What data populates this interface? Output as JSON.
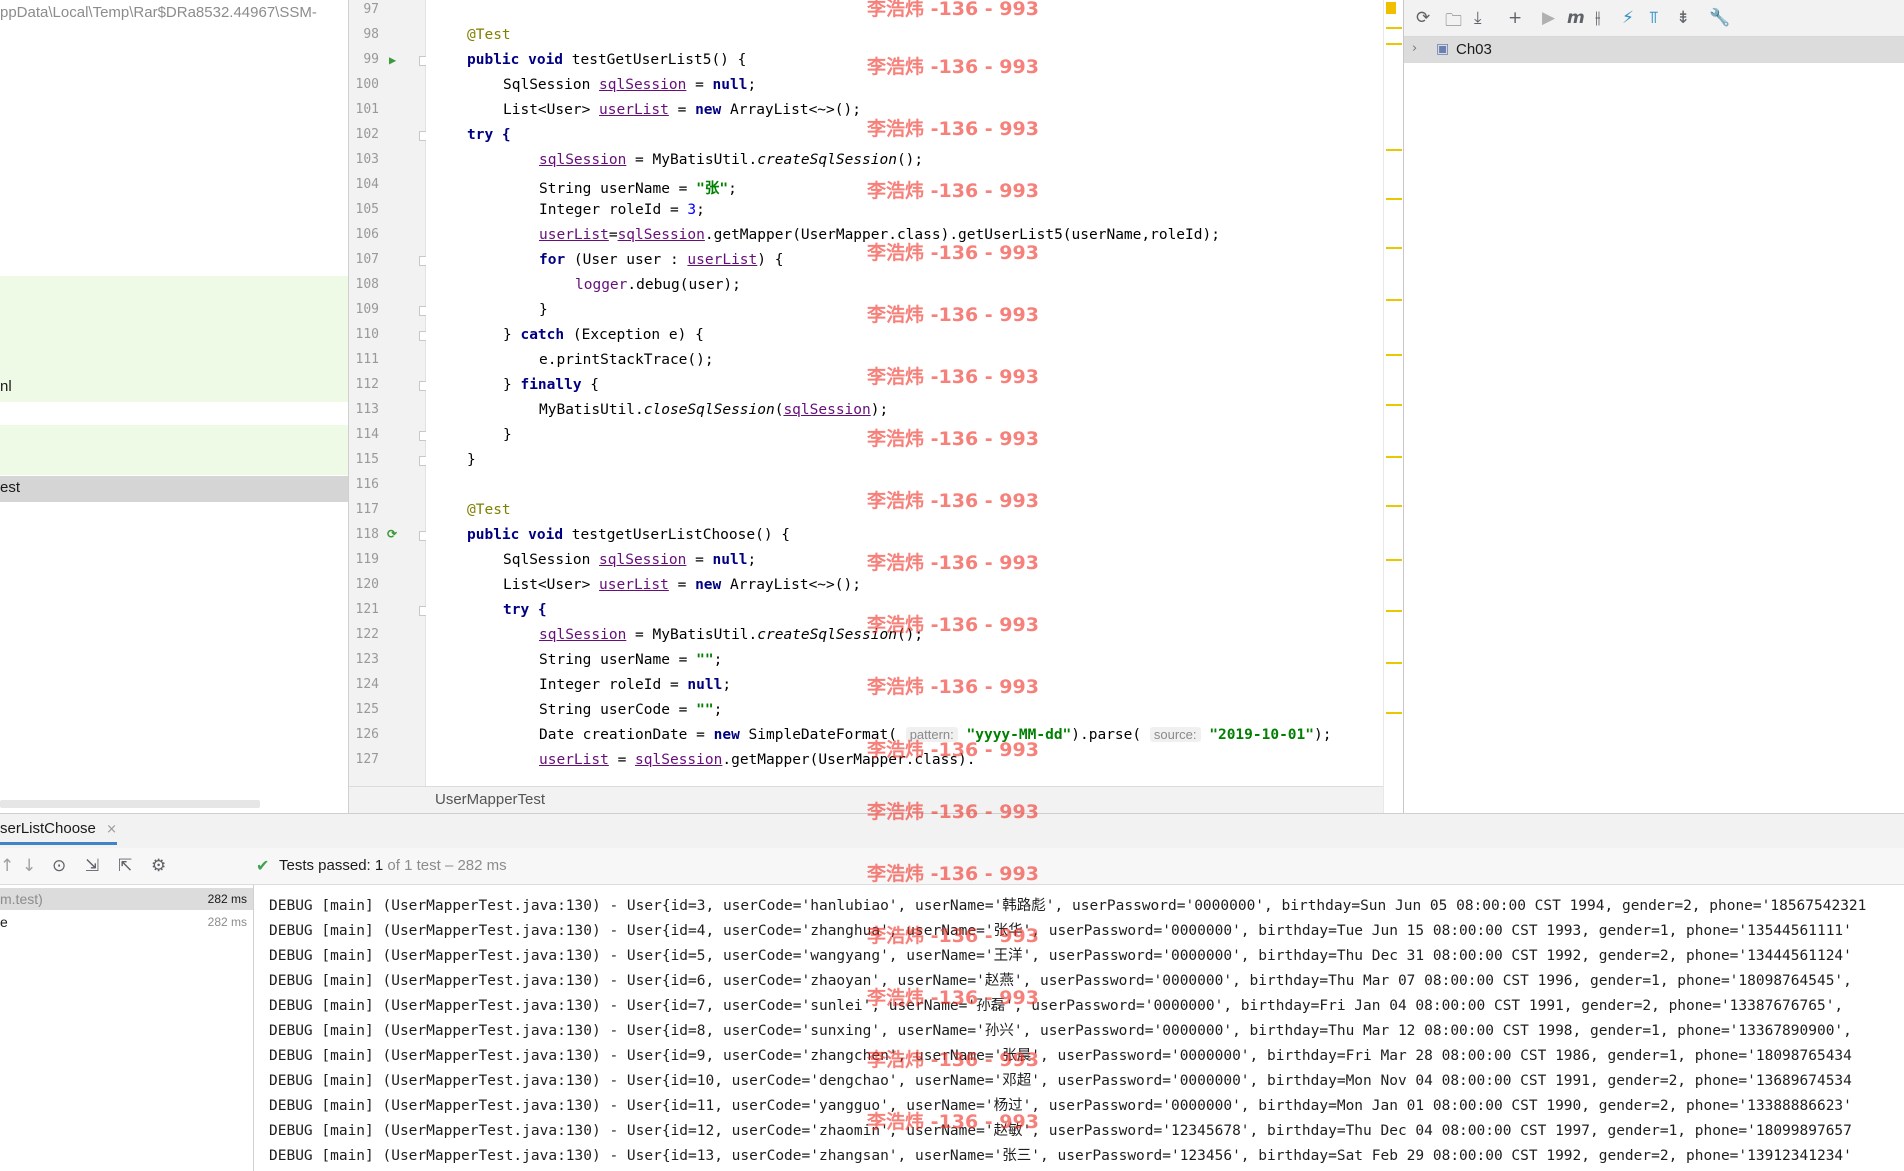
{
  "left_panel": {
    "path_text": "ppData\\Local\\Temp\\Rar$DRa8532.44967\\SSM-",
    "row_ml": "nl",
    "row_test": "est"
  },
  "maven": {
    "project": "Ch03"
  },
  "editor": {
    "tab_label": "UserMapperTest",
    "line_numbers": [
      "97",
      "98",
      "99",
      "100",
      "101",
      "102",
      "103",
      "104",
      "105",
      "106",
      "107",
      "108",
      "109",
      "110",
      "111",
      "112",
      "113",
      "114",
      "115",
      "116",
      "117",
      "118",
      "119",
      "120",
      "121",
      "122",
      "123",
      "124",
      "125",
      "126",
      "127"
    ]
  },
  "code": {
    "l98": "@Test",
    "l99": "public void testGetUserList5() {",
    "l100": "SqlSession sqlSession = null;",
    "l101": "List<User> userList = new ArrayList<~>();",
    "l102": "try {",
    "l103": "sqlSession = MyBatisUtil.createSqlSession();",
    "l104": "String userName = \"张\";",
    "l105": "Integer roleId = 3;",
    "l106": "userList=sqlSession.getMapper(UserMapper.class).getUserList5(userName,roleId);",
    "l107": "for (User user : userList) {",
    "l108": "logger.debug(user);",
    "l109": "}",
    "l110": "} catch (Exception e) {",
    "l111": "e.printStackTrace();",
    "l112": "} finally {",
    "l113": "MyBatisUtil.closeSqlSession(sqlSession);",
    "l114": "}",
    "l115": "}",
    "l117": "@Test",
    "l118": "public void testgetUserListChoose() {",
    "l119": "SqlSession sqlSession = null;",
    "l120": "List<User> userList = new ArrayList<~>();",
    "l121": "try {",
    "l122": "sqlSession = MyBatisUtil.createSqlSession();",
    "l123": "String userName = \"\";",
    "l124": "Integer roleId = null;",
    "l125": "String userCode = \"\";",
    "l126": "Date creationDate = new SimpleDateFormat( pattern: \"yyyy-MM-dd\").parse( source: \"2019-10-01\");",
    "l127": "userList = sqlSession.getMapper(UserMapper.class)."
  },
  "run": {
    "tab_label": "serListChoose",
    "status_label": "Tests passed:",
    "passed": "1",
    "of_total": "of 1 test",
    "duration": "– 282 ms",
    "tree": [
      {
        "name": "m.test)",
        "time": "282 ms"
      },
      {
        "name": "e",
        "time": "282 ms"
      }
    ]
  },
  "log_lines": [
    "DEBUG [main] (UserMapperTest.java:130) - User{id=3, userCode='hanlubiao', userName='韩路彪', userPassword='0000000', birthday=Sun Jun 05 08:00:00 CST 1994, gender=2, phone='18567542321",
    "DEBUG [main] (UserMapperTest.java:130) - User{id=4, userCode='zhanghua', userName='张华', userPassword='0000000', birthday=Tue Jun 15 08:00:00 CST 1993, gender=1, phone='13544561111'",
    "DEBUG [main] (UserMapperTest.java:130) - User{id=5, userCode='wangyang', userName='王洋', userPassword='0000000', birthday=Thu Dec 31 08:00:00 CST 1992, gender=2, phone='13444561124'",
    "DEBUG [main] (UserMapperTest.java:130) - User{id=6, userCode='zhaoyan', userName='赵燕', userPassword='0000000', birthday=Thu Mar 07 08:00:00 CST 1996, gender=1, phone='18098764545',",
    "DEBUG [main] (UserMapperTest.java:130) - User{id=7, userCode='sunlei', userName='孙磊', userPassword='0000000', birthday=Fri Jan 04 08:00:00 CST 1991, gender=2, phone='13387676765',",
    "DEBUG [main] (UserMapperTest.java:130) - User{id=8, userCode='sunxing', userName='孙兴', userPassword='0000000', birthday=Thu Mar 12 08:00:00 CST 1998, gender=1, phone='13367890900',",
    "DEBUG [main] (UserMapperTest.java:130) - User{id=9, userCode='zhangchen', userName='张晨', userPassword='0000000', birthday=Fri Mar 28 08:00:00 CST 1986, gender=1, phone='18098765434",
    "DEBUG [main] (UserMapperTest.java:130) - User{id=10, userCode='dengchao', userName='邓超', userPassword='0000000', birthday=Mon Nov 04 08:00:00 CST 1991, gender=2, phone='13689674534",
    "DEBUG [main] (UserMapperTest.java:130) - User{id=11, userCode='yangguo', userName='杨过', userPassword='0000000', birthday=Mon Jan 01 08:00:00 CST 1990, gender=2, phone='13388886623'",
    "DEBUG [main] (UserMapperTest.java:130) - User{id=12, userCode='zhaomin', userName='赵敏', userPassword='12345678', birthday=Thu Dec 04 08:00:00 CST 1997, gender=1, phone='18099897657",
    "DEBUG [main] (UserMapperTest.java:130) - User{id=13, userCode='zhangsan', userName='张三', userPassword='123456', birthday=Sat Feb 29 08:00:00 CST 1992, gender=2, phone='13912341234'"
  ],
  "watermark": "李浩炜 -136 - 993",
  "colors": {
    "watermark": "#f03228",
    "keyword": "#000080",
    "string": "#008000",
    "annotation": "#808000",
    "pass_check": "#3fa34d",
    "stripe_mark": "#e8c800"
  },
  "icons": [
    "refresh-icon",
    "add-project-folder-icon",
    "download-icon",
    "add-icon",
    "run-icon",
    "maven-goal-icon",
    "toggle-offline-icon",
    "skip-tests-icon",
    "show-dependencies-icon",
    "collapse-all-icon",
    "settings-wrench-icon",
    "maven-module-icon",
    "run-gutter-icon",
    "rerun-gutter-icon",
    "check-icon",
    "close-icon"
  ]
}
